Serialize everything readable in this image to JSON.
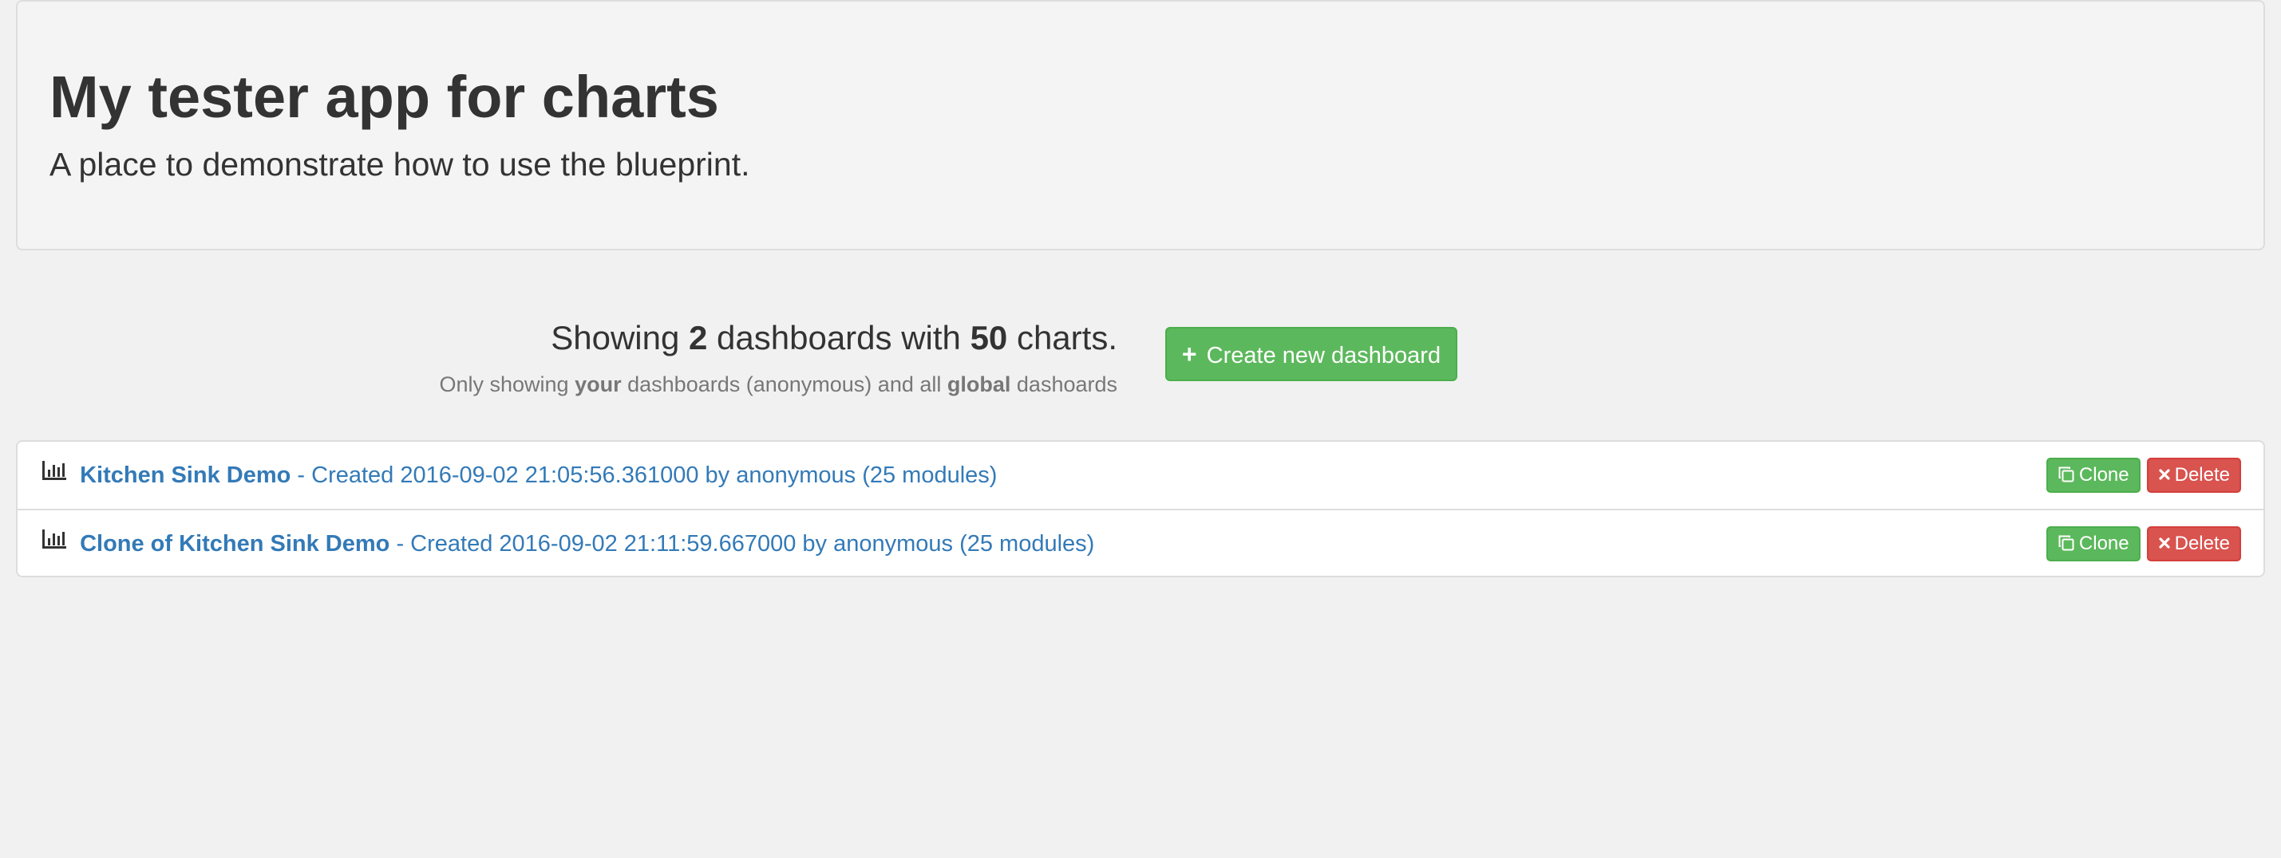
{
  "header": {
    "title": "My tester app for charts",
    "subtitle": "A place to demonstrate how to use the blueprint."
  },
  "summary": {
    "prefix": "Showing",
    "dashboard_count": "2",
    "middle": "dashboards with",
    "chart_count": "50",
    "suffix": "charts.",
    "note_prefix": "Only showing",
    "note_bold_1": "your",
    "note_middle": "dashboards (anonymous) and all",
    "note_bold_2": "global",
    "note_suffix": "dashoards"
  },
  "create_button": {
    "label": "Create new dashboard",
    "icon": "plus-icon"
  },
  "dashboards": [
    {
      "name": "Kitchen Sink Demo",
      "meta": "- Created 2016-09-02 21:05:56.361000 by anonymous (25 modules)",
      "icon": "bar-chart-icon",
      "clone_label": "Clone",
      "delete_label": "Delete"
    },
    {
      "name": "Clone of Kitchen Sink Demo",
      "meta": "- Created 2016-09-02 21:11:59.667000 by anonymous (25 modules)",
      "icon": "bar-chart-icon",
      "clone_label": "Clone",
      "delete_label": "Delete"
    }
  ],
  "colors": {
    "background": "#f1f1f1",
    "jumbotron": "#f4f4f4",
    "link": "#337ab7",
    "success": "#5cb85c",
    "danger": "#d9534f"
  }
}
